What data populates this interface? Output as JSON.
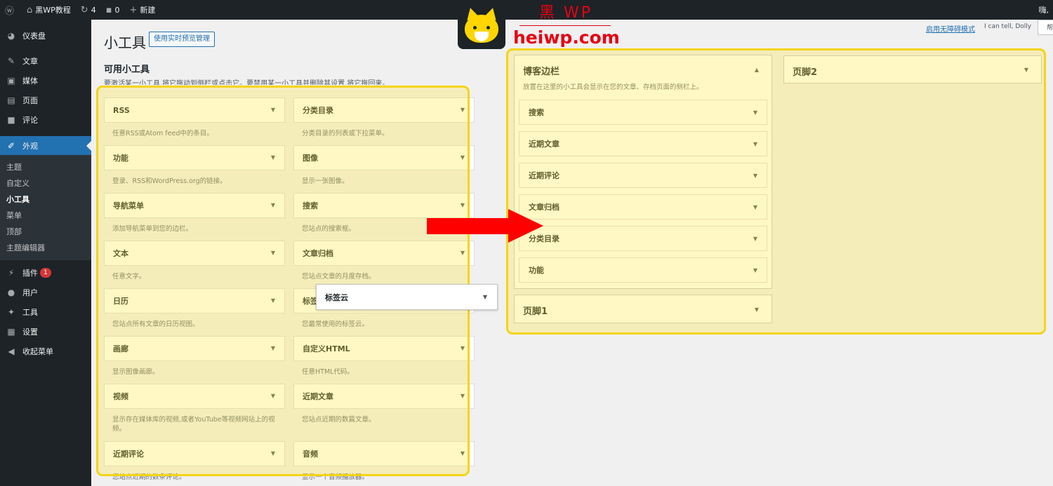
{
  "adminbar": {
    "wp_logo": "wordpress-icon",
    "site_name": "黑WP教程",
    "updates_count": "4",
    "comments_count": "0",
    "new_label": "新建",
    "greeting": "嗨,"
  },
  "sidebar": {
    "items": [
      {
        "icon": "dashboard-icon",
        "label": "仪表盘"
      },
      {
        "icon": "pin-icon",
        "label": "文章"
      },
      {
        "icon": "media-icon",
        "label": "媒体"
      },
      {
        "icon": "page-icon",
        "label": "页面"
      },
      {
        "icon": "comment-icon",
        "label": "评论"
      },
      {
        "icon": "brush-icon",
        "label": "外观"
      },
      {
        "icon": "plugin-icon",
        "label": "插件",
        "badge": "1"
      },
      {
        "icon": "user-icon",
        "label": "用户"
      },
      {
        "icon": "wrench-icon",
        "label": "工具"
      },
      {
        "icon": "settings-icon",
        "label": "设置"
      },
      {
        "icon": "collapse-icon",
        "label": "收起菜单"
      }
    ],
    "submenu": [
      "主题",
      "自定义",
      "小工具",
      "菜单",
      "顶部",
      "主题编辑器"
    ]
  },
  "header": {
    "title": "小工具",
    "preview_button": "使用实时预览管理",
    "accessibility_link": "启用无障碍模式",
    "dolly": "I can tell, Dolly",
    "help": "帮"
  },
  "available": {
    "title": "可用小工具",
    "desc": "要激活某一小工具,将它拖动到侧栏或点击它。要禁用某一小工具并删除其设置,将它拖回来。",
    "widgets": [
      {
        "name": "RSS",
        "desc": "任意RSS或Atom feed中的条目。"
      },
      {
        "name": "分类目录",
        "desc": "分类目录的列表或下拉菜单。"
      },
      {
        "name": "功能",
        "desc": "登录、RSS和WordPress.org的链接。"
      },
      {
        "name": "图像",
        "desc": "显示一张图像。"
      },
      {
        "name": "导航菜单",
        "desc": "添加导航菜单到您的边栏。"
      },
      {
        "name": "搜索",
        "desc": "您站点的搜索框。"
      },
      {
        "name": "文本",
        "desc": "任意文字。"
      },
      {
        "name": "文章归档",
        "desc": "您站点文章的月度存档。"
      },
      {
        "name": "日历",
        "desc": "您站点所有文章的日历视图。"
      },
      {
        "name": "标签云",
        "desc": "您最常使用的标签云。"
      },
      {
        "name": "画廊",
        "desc": "显示图像画廊。"
      },
      {
        "name": "自定义HTML",
        "desc": "任意HTML代码。"
      },
      {
        "name": "视频",
        "desc": "显示存在媒体库的视频,或者YouTube等视频网站上的视频。"
      },
      {
        "name": "近期文章",
        "desc": "您站点近期的数篇文章。"
      },
      {
        "name": "近期评论",
        "desc": "您站点近期的数条评论。"
      },
      {
        "name": "音频",
        "desc": "显示一个音频播放器。"
      }
    ],
    "dragging": "标签云"
  },
  "sidebars": {
    "blog": {
      "title": "博客边栏",
      "desc": "放置在这里的小工具会显示在您的文章、存档页面的侧栏上。",
      "widgets": [
        "搜索",
        "近期文章",
        "近期评论",
        "文章归档",
        "分类目录",
        "功能"
      ]
    },
    "footer1": {
      "title": "页脚1"
    },
    "footer2": {
      "title": "页脚2"
    }
  },
  "brand": {
    "cn": "黑 WP",
    "en": "heiwp.com"
  },
  "colors": {
    "highlight": "#f5d417",
    "arrow": "#ff0000",
    "accent": "#2271b1",
    "brand": "#e60012"
  }
}
